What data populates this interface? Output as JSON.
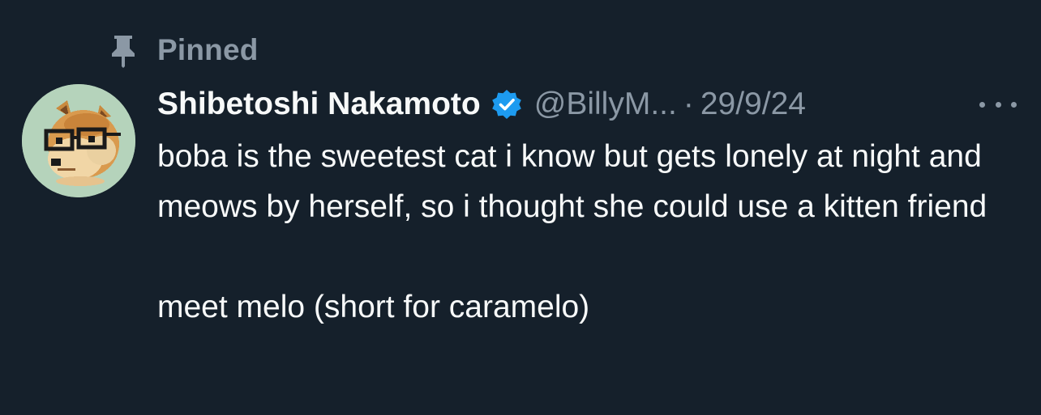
{
  "pinned": {
    "icon": "pin-icon",
    "label": "Pinned"
  },
  "author": {
    "avatar_icon": "doge-glasses-avatar",
    "display_name": "Shibetoshi Nakamoto",
    "verified_icon": "verified-badge-icon",
    "handle": "@BillyM...",
    "separator": "·",
    "date": "29/9/24"
  },
  "more": {
    "icon": "more-options-icon"
  },
  "body": {
    "paragraph1": "boba is the sweetest cat i know but gets lonely at night and meows by herself, so i thought she could use a kitten friend",
    "paragraph2": "meet melo (short for caramelo)"
  },
  "colors": {
    "background": "#15202b",
    "text": "#f7f9f9",
    "secondary": "#8b98a5",
    "verified": "#1d9bf0",
    "avatar_bg": "#b5d3bb"
  }
}
